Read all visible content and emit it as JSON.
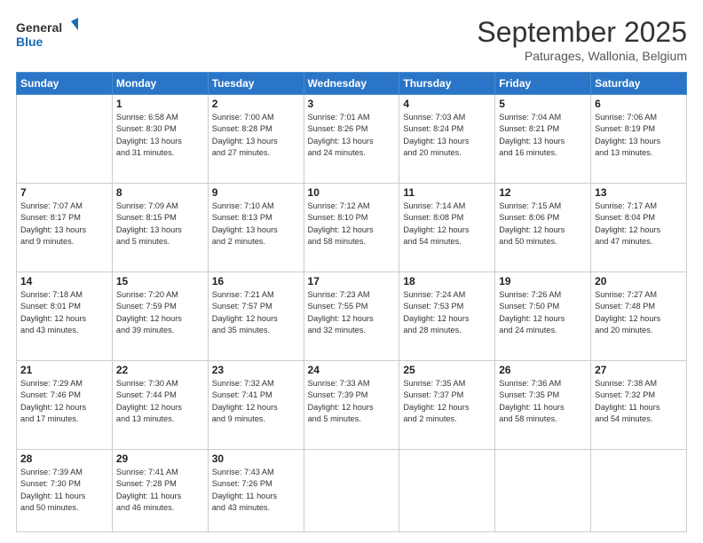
{
  "header": {
    "logo_general": "General",
    "logo_blue": "Blue",
    "month_title": "September 2025",
    "location": "Paturages, Wallonia, Belgium"
  },
  "weekdays": [
    "Sunday",
    "Monday",
    "Tuesday",
    "Wednesday",
    "Thursday",
    "Friday",
    "Saturday"
  ],
  "weeks": [
    [
      {
        "day": "",
        "info": ""
      },
      {
        "day": "1",
        "info": "Sunrise: 6:58 AM\nSunset: 8:30 PM\nDaylight: 13 hours\nand 31 minutes."
      },
      {
        "day": "2",
        "info": "Sunrise: 7:00 AM\nSunset: 8:28 PM\nDaylight: 13 hours\nand 27 minutes."
      },
      {
        "day": "3",
        "info": "Sunrise: 7:01 AM\nSunset: 8:26 PM\nDaylight: 13 hours\nand 24 minutes."
      },
      {
        "day": "4",
        "info": "Sunrise: 7:03 AM\nSunset: 8:24 PM\nDaylight: 13 hours\nand 20 minutes."
      },
      {
        "day": "5",
        "info": "Sunrise: 7:04 AM\nSunset: 8:21 PM\nDaylight: 13 hours\nand 16 minutes."
      },
      {
        "day": "6",
        "info": "Sunrise: 7:06 AM\nSunset: 8:19 PM\nDaylight: 13 hours\nand 13 minutes."
      }
    ],
    [
      {
        "day": "7",
        "info": "Sunrise: 7:07 AM\nSunset: 8:17 PM\nDaylight: 13 hours\nand 9 minutes."
      },
      {
        "day": "8",
        "info": "Sunrise: 7:09 AM\nSunset: 8:15 PM\nDaylight: 13 hours\nand 5 minutes."
      },
      {
        "day": "9",
        "info": "Sunrise: 7:10 AM\nSunset: 8:13 PM\nDaylight: 13 hours\nand 2 minutes."
      },
      {
        "day": "10",
        "info": "Sunrise: 7:12 AM\nSunset: 8:10 PM\nDaylight: 12 hours\nand 58 minutes."
      },
      {
        "day": "11",
        "info": "Sunrise: 7:14 AM\nSunset: 8:08 PM\nDaylight: 12 hours\nand 54 minutes."
      },
      {
        "day": "12",
        "info": "Sunrise: 7:15 AM\nSunset: 8:06 PM\nDaylight: 12 hours\nand 50 minutes."
      },
      {
        "day": "13",
        "info": "Sunrise: 7:17 AM\nSunset: 8:04 PM\nDaylight: 12 hours\nand 47 minutes."
      }
    ],
    [
      {
        "day": "14",
        "info": "Sunrise: 7:18 AM\nSunset: 8:01 PM\nDaylight: 12 hours\nand 43 minutes."
      },
      {
        "day": "15",
        "info": "Sunrise: 7:20 AM\nSunset: 7:59 PM\nDaylight: 12 hours\nand 39 minutes."
      },
      {
        "day": "16",
        "info": "Sunrise: 7:21 AM\nSunset: 7:57 PM\nDaylight: 12 hours\nand 35 minutes."
      },
      {
        "day": "17",
        "info": "Sunrise: 7:23 AM\nSunset: 7:55 PM\nDaylight: 12 hours\nand 32 minutes."
      },
      {
        "day": "18",
        "info": "Sunrise: 7:24 AM\nSunset: 7:53 PM\nDaylight: 12 hours\nand 28 minutes."
      },
      {
        "day": "19",
        "info": "Sunrise: 7:26 AM\nSunset: 7:50 PM\nDaylight: 12 hours\nand 24 minutes."
      },
      {
        "day": "20",
        "info": "Sunrise: 7:27 AM\nSunset: 7:48 PM\nDaylight: 12 hours\nand 20 minutes."
      }
    ],
    [
      {
        "day": "21",
        "info": "Sunrise: 7:29 AM\nSunset: 7:46 PM\nDaylight: 12 hours\nand 17 minutes."
      },
      {
        "day": "22",
        "info": "Sunrise: 7:30 AM\nSunset: 7:44 PM\nDaylight: 12 hours\nand 13 minutes."
      },
      {
        "day": "23",
        "info": "Sunrise: 7:32 AM\nSunset: 7:41 PM\nDaylight: 12 hours\nand 9 minutes."
      },
      {
        "day": "24",
        "info": "Sunrise: 7:33 AM\nSunset: 7:39 PM\nDaylight: 12 hours\nand 5 minutes."
      },
      {
        "day": "25",
        "info": "Sunrise: 7:35 AM\nSunset: 7:37 PM\nDaylight: 12 hours\nand 2 minutes."
      },
      {
        "day": "26",
        "info": "Sunrise: 7:36 AM\nSunset: 7:35 PM\nDaylight: 11 hours\nand 58 minutes."
      },
      {
        "day": "27",
        "info": "Sunrise: 7:38 AM\nSunset: 7:32 PM\nDaylight: 11 hours\nand 54 minutes."
      }
    ],
    [
      {
        "day": "28",
        "info": "Sunrise: 7:39 AM\nSunset: 7:30 PM\nDaylight: 11 hours\nand 50 minutes."
      },
      {
        "day": "29",
        "info": "Sunrise: 7:41 AM\nSunset: 7:28 PM\nDaylight: 11 hours\nand 46 minutes."
      },
      {
        "day": "30",
        "info": "Sunrise: 7:43 AM\nSunset: 7:26 PM\nDaylight: 11 hours\nand 43 minutes."
      },
      {
        "day": "",
        "info": ""
      },
      {
        "day": "",
        "info": ""
      },
      {
        "day": "",
        "info": ""
      },
      {
        "day": "",
        "info": ""
      }
    ]
  ]
}
